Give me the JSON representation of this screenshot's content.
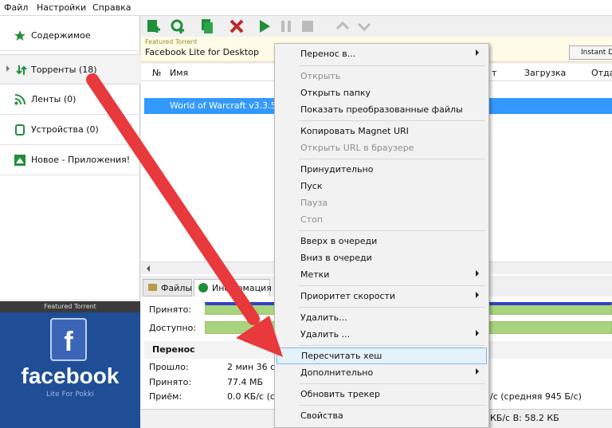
{
  "menubar": {
    "items": [
      "Файл",
      "Настройки",
      "Справка"
    ]
  },
  "sidebar": {
    "items": [
      {
        "label": "Содержимое",
        "icon": "star-icon"
      },
      {
        "label": "Торренты (18)",
        "icon": "torrents-icon"
      },
      {
        "label": "Ленты (0)",
        "icon": "rss-icon"
      },
      {
        "label": "Устройства (0)",
        "icon": "devices-icon"
      },
      {
        "label": "Новое - Приложения!",
        "icon": "apps-icon"
      }
    ]
  },
  "ad": {
    "header": "Featured Torrent",
    "brand": "facebook",
    "sub": "Lite For Pokki"
  },
  "featured": {
    "small": "Featured Torrent",
    "title": "Facebook Lite for Desktop",
    "button": "Instant D"
  },
  "grid": {
    "columns": [
      "№",
      "Имя",
      "т",
      "Загрузка",
      "Отда"
    ],
    "selected_row": "World of Warcraft v3.3.5"
  },
  "tabs": [
    "Файлы",
    "Информация"
  ],
  "info": {
    "received_label": "Принято:",
    "available_label": "Доступно:",
    "section": "Перенос",
    "rows": [
      {
        "label": "Прошло:",
        "value": "2 мин 36 с"
      },
      {
        "label": "Принято:",
        "value": "77.4 МБ"
      },
      {
        "label": "Приём:",
        "value": "0.0 КБ/с (ср"
      }
    ],
    "right_text": "/с (средняя 945 Б/с)"
  },
  "status": {
    "text": "КБ/с В: 58.2 КБ"
  },
  "context_menu": {
    "items": [
      {
        "label": "Перенос в...",
        "disabled": false,
        "submenu": true
      },
      {
        "label": "Открыть",
        "disabled": true,
        "submenu": false
      },
      {
        "label": "Открыть папку",
        "disabled": false,
        "submenu": false
      },
      {
        "label": "Показать преобразованные файлы",
        "disabled": false,
        "submenu": false
      },
      {
        "label": "Копировать Magnet URI",
        "disabled": false,
        "submenu": false
      },
      {
        "label": "Открыть URL в браузере",
        "disabled": true,
        "submenu": false
      },
      {
        "label": "Принудительно",
        "disabled": false,
        "submenu": false
      },
      {
        "label": "Пуск",
        "disabled": false,
        "submenu": false
      },
      {
        "label": "Пауза",
        "disabled": true,
        "submenu": false
      },
      {
        "label": "Стоп",
        "disabled": true,
        "submenu": false
      },
      {
        "label": "Вверх в очереди",
        "disabled": false,
        "submenu": false
      },
      {
        "label": "Вниз в очереди",
        "disabled": false,
        "submenu": false
      },
      {
        "label": "Метки",
        "disabled": false,
        "submenu": true
      },
      {
        "label": "Приоритет скорости",
        "disabled": false,
        "submenu": true
      },
      {
        "label": "Удалить...",
        "disabled": false,
        "submenu": false
      },
      {
        "label": "Удалить ...",
        "disabled": false,
        "submenu": true
      },
      {
        "label": "Пересчитать хеш",
        "disabled": false,
        "submenu": false,
        "highlighted": true
      },
      {
        "label": "Дополнительно",
        "disabled": false,
        "submenu": true
      },
      {
        "label": "Обновить трекер",
        "disabled": false,
        "submenu": false
      },
      {
        "label": "Свойства",
        "disabled": false,
        "submenu": false
      }
    ]
  },
  "colors": {
    "accent": "#3399ff",
    "arrow": "#e8393d",
    "progress": "#a8d47c"
  }
}
